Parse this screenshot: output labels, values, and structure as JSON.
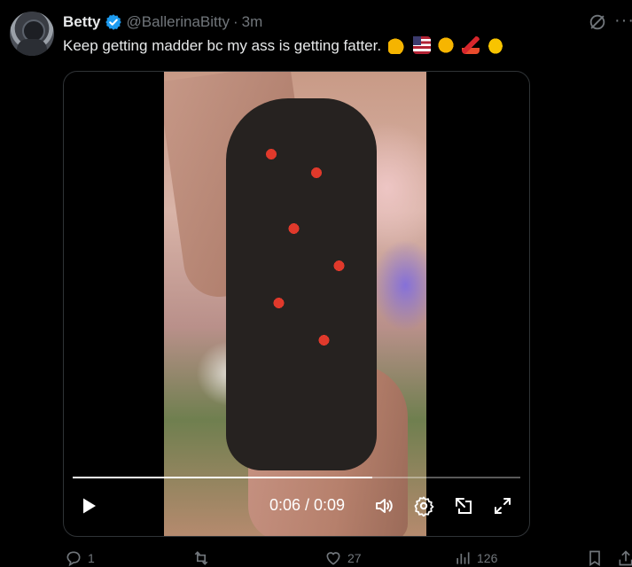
{
  "author": {
    "name": "Betty",
    "handle": "@BallerinaBitty",
    "separator": "·",
    "time": "3m"
  },
  "tweet": {
    "text": "Keep getting madder bc my ass is getting fatter.",
    "emojis": [
      "flexed-biceps",
      "us-flag",
      "face-with-hand-over-mouth",
      "nail-polish",
      "heart-hands"
    ]
  },
  "video": {
    "timecode": "0:06 / 0:09",
    "progress": 0.67
  },
  "actions": {
    "replies": "1",
    "reposts": "",
    "likes": "27",
    "views": "126"
  },
  "colors": {
    "background": "#000000",
    "text": "#e7e9ea",
    "muted": "#71767b",
    "verified": "#1d9bf0",
    "border": "#2f3336"
  }
}
